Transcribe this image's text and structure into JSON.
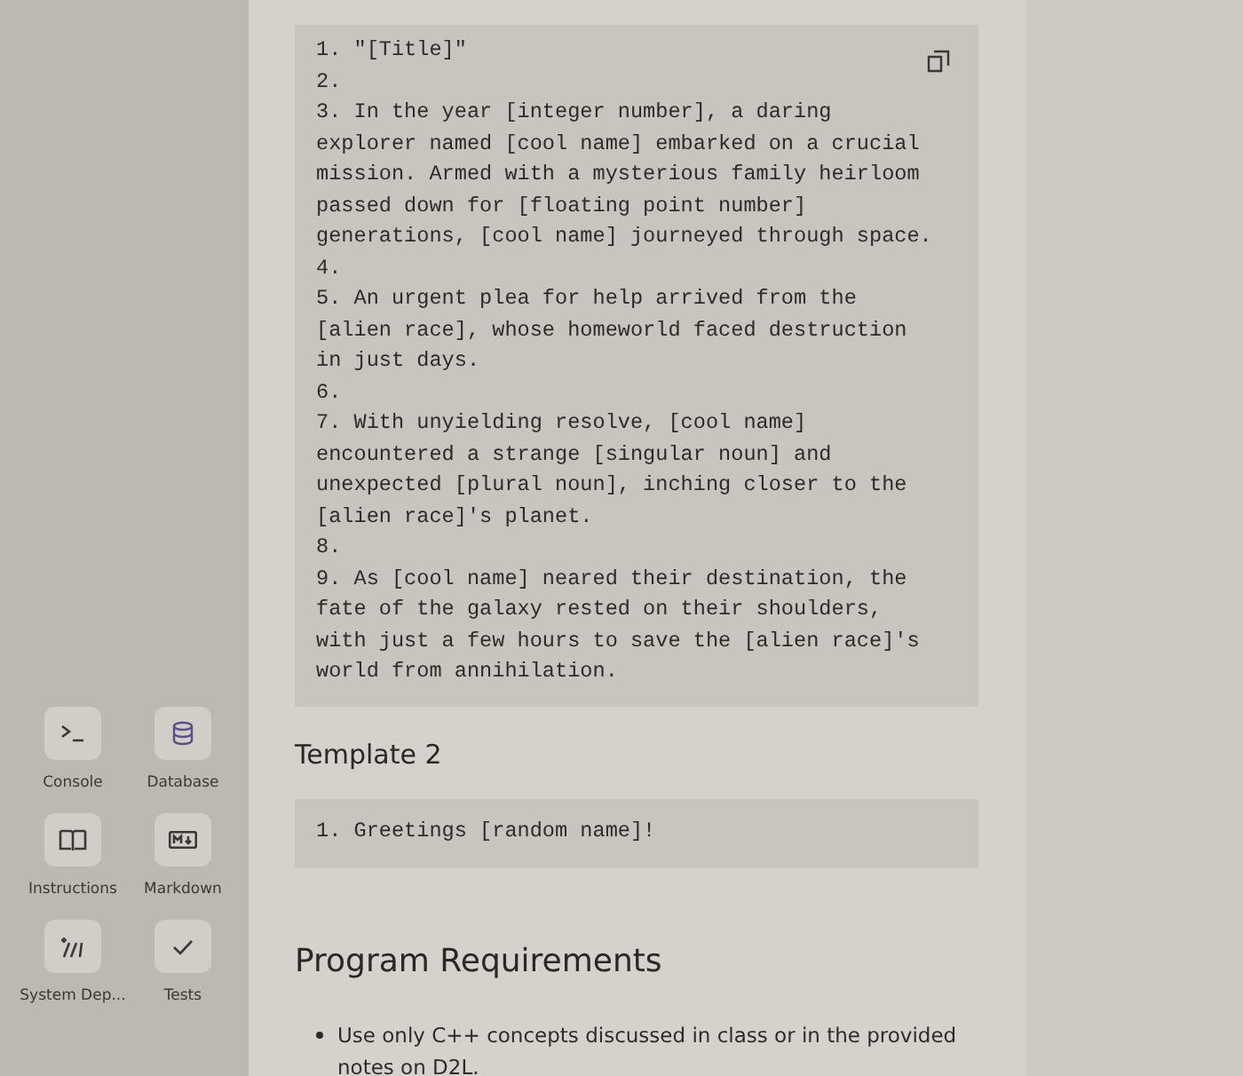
{
  "sidebar": {
    "tools": [
      {
        "kind": "console",
        "label": "Console"
      },
      {
        "kind": "database",
        "label": "Database"
      },
      {
        "kind": "instructions",
        "label": "Instructions"
      },
      {
        "kind": "markdown",
        "label": "Markdown"
      },
      {
        "kind": "system",
        "label": "System Dep..."
      },
      {
        "kind": "tests",
        "label": "Tests"
      }
    ]
  },
  "content": {
    "code_block_1": {
      "lines": [
        "1. \"[Title]\"",
        "2.",
        "3. In the year [integer number], a daring explorer named [cool name] embarked on a crucial mission. Armed with a mysterious family heirloom passed down for [floating point number] generations, [cool name] journeyed through space.",
        "4.",
        "5. An urgent plea for help arrived from the [alien race], whose homeworld faced destruction in just days.",
        "6.",
        "7. With unyielding resolve, [cool name] encountered a strange [singular noun] and unexpected [plural noun], inching closer to the [alien race]'s planet.",
        "8.",
        "9. As [cool name] neared their destination, the fate of the galaxy rested on their shoulders, with just a few hours to save the [alien race]'s world from annihilation."
      ]
    },
    "template_heading": "Template 2",
    "code_block_2": {
      "lines": [
        "1. Greetings [random name]!"
      ]
    },
    "section_heading": "Program Requirements",
    "requirements": [
      "Use only C++ concepts discussed in class or in the provided notes on D2L."
    ]
  }
}
